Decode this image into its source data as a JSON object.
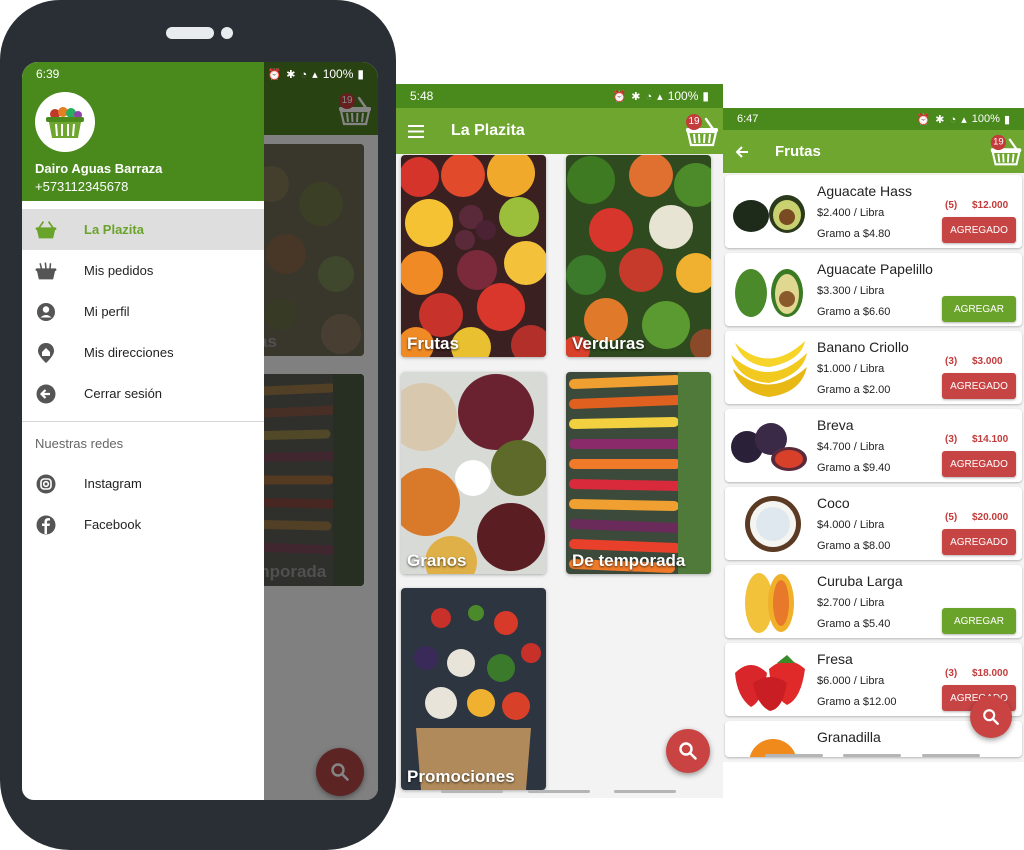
{
  "colors": {
    "primary_dark": "#4a8a1d",
    "primary": "#6ea62f",
    "accent_red": "#c74444",
    "add_green": "#6aa32a"
  },
  "phone1": {
    "status": {
      "time": "6:39",
      "battery": "100%"
    },
    "user": {
      "name": "Dairo Aguas Barraza",
      "phone": "+573112345678"
    },
    "menu": [
      {
        "label": "La Plazita",
        "icon": "basket-icon",
        "active": true
      },
      {
        "label": "Mis pedidos",
        "icon": "orders-basket-icon",
        "active": false
      },
      {
        "label": "Mi perfil",
        "icon": "profile-icon",
        "active": false
      },
      {
        "label": "Mis direcciones",
        "icon": "home-location-icon",
        "active": false
      },
      {
        "label": "Cerrar sesión",
        "icon": "logout-arrow-icon",
        "active": false
      }
    ],
    "networks_title": "Nuestras redes",
    "networks": [
      {
        "label": "Instagram",
        "icon": "instagram-icon"
      },
      {
        "label": "Facebook",
        "icon": "facebook-icon"
      }
    ],
    "background_labels": [
      "uras",
      "emporada"
    ],
    "cart_count": "19"
  },
  "screen2": {
    "status": {
      "time": "5:48",
      "battery": "100%"
    },
    "title": "La Plazita",
    "cart_count": "19",
    "categories": [
      "Frutas",
      "Verduras",
      "Granos",
      "De temporada",
      "Promociones"
    ]
  },
  "screen3": {
    "status": {
      "time": "6:47",
      "battery": "100%"
    },
    "title": "Frutas",
    "cart_count": "19",
    "products": [
      {
        "name": "Aguacate Hass",
        "price": "$2.400 / Libra",
        "gram": "Gramo a $4.80",
        "qty": "(5)",
        "total": "$12.000",
        "button": "AGREGADO",
        "in_cart": true
      },
      {
        "name": "Aguacate Papelillo",
        "price": "$3.300 / Libra",
        "gram": "Gramo a $6.60",
        "qty": "",
        "total": "",
        "button": "AGREGAR",
        "in_cart": false
      },
      {
        "name": "Banano Criollo",
        "price": "$1.000 / Libra",
        "gram": "Gramo a $2.00",
        "qty": "(3)",
        "total": "$3.000",
        "button": "AGREGADO",
        "in_cart": true
      },
      {
        "name": "Breva",
        "price": "$4.700 / Libra",
        "gram": "Gramo a $9.40",
        "qty": "(3)",
        "total": "$14.100",
        "button": "AGREGADO",
        "in_cart": true
      },
      {
        "name": "Coco",
        "price": "$4.000 / Libra",
        "gram": "Gramo a $8.00",
        "qty": "(5)",
        "total": "$20.000",
        "button": "AGREGADO",
        "in_cart": true
      },
      {
        "name": "Curuba Larga",
        "price": "$2.700 / Libra",
        "gram": "Gramo a $5.40",
        "qty": "",
        "total": "",
        "button": "AGREGAR",
        "in_cart": false
      },
      {
        "name": "Fresa",
        "price": "$6.000 / Libra",
        "gram": "Gramo a $12.00",
        "qty": "(3)",
        "total": "$18.000",
        "button": "AGREGADO",
        "in_cart": true
      },
      {
        "name": "Granadilla",
        "price": "",
        "gram": "",
        "qty": "",
        "total": "",
        "button": "",
        "in_cart": false
      }
    ]
  }
}
